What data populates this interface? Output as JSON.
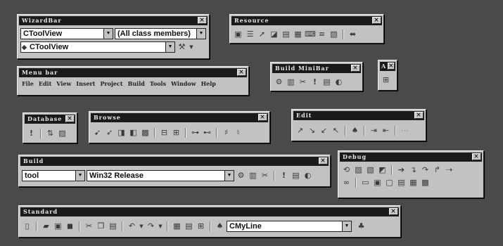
{
  "toolbars": {
    "wizardbar": {
      "title": "WizardBar",
      "class_combo": "CToolView",
      "members_combo": "(All class members)",
      "function_combo": "CToolView"
    },
    "resource": {
      "title": "Resource"
    },
    "menubar": {
      "title": "Menu bar",
      "items": [
        "File",
        "Edit",
        "View",
        "Insert",
        "Project",
        "Build",
        "Tools",
        "Window",
        "Help"
      ]
    },
    "build_minibar": {
      "title": "Build MiniBar"
    },
    "small_palette": {
      "title": "A"
    },
    "database": {
      "title": "Database"
    },
    "browse": {
      "title": "Browse"
    },
    "edit": {
      "title": "Edit"
    },
    "build": {
      "title": "Build",
      "target_combo": "tool",
      "config_combo": "Win32 Release"
    },
    "debug": {
      "title": "Debug"
    },
    "standard": {
      "title": "Standard",
      "find_combo": "CMyLine"
    }
  },
  "close_glyph": "×"
}
